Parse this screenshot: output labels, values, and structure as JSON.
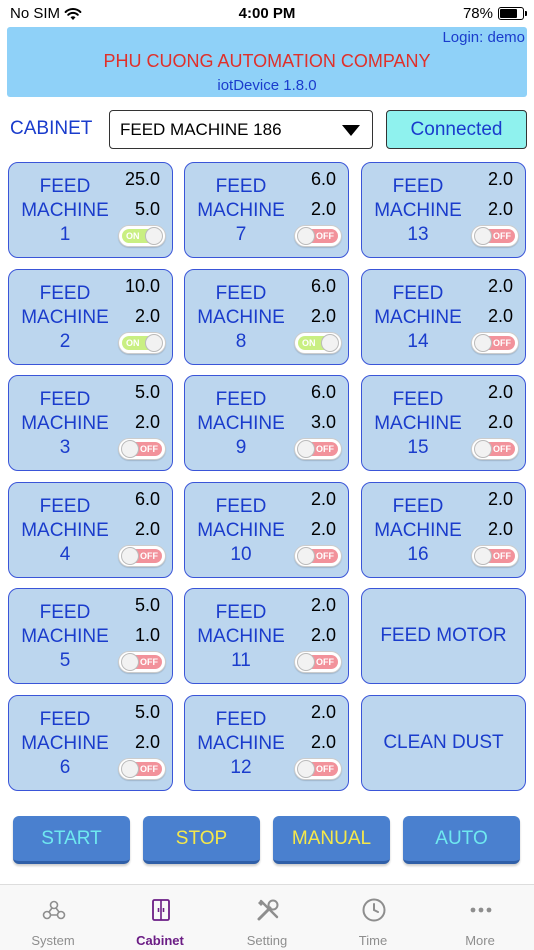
{
  "status_bar": {
    "carrier": "No SIM",
    "time": "4:00 PM",
    "battery": "78%",
    "battery_level": 0.78
  },
  "banner": {
    "login": "Login: demo",
    "company": "PHU CUONG AUTOMATION COMPANY",
    "version": "iotDevice 1.8.0"
  },
  "cabinet": {
    "label": "CABINET",
    "selected": "FEED MACHINE 186",
    "connection_status": "Connected"
  },
  "machines": [
    {
      "line1": "FEED",
      "line2": "MACHINE",
      "number": "1",
      "value1": "25.0",
      "value2": "5.0",
      "switch": "ON"
    },
    {
      "line1": "FEED",
      "line2": "MACHINE",
      "number": "2",
      "value1": "10.0",
      "value2": "2.0",
      "switch": "ON"
    },
    {
      "line1": "FEED",
      "line2": "MACHINE",
      "number": "3",
      "value1": "5.0",
      "value2": "2.0",
      "switch": "OFF"
    },
    {
      "line1": "FEED",
      "line2": "MACHINE",
      "number": "4",
      "value1": "6.0",
      "value2": "2.0",
      "switch": "OFF"
    },
    {
      "line1": "FEED",
      "line2": "MACHINE",
      "number": "5",
      "value1": "5.0",
      "value2": "1.0",
      "switch": "OFF"
    },
    {
      "line1": "FEED",
      "line2": "MACHINE",
      "number": "6",
      "value1": "5.0",
      "value2": "2.0",
      "switch": "OFF"
    },
    {
      "line1": "FEED",
      "line2": "MACHINE",
      "number": "7",
      "value1": "6.0",
      "value2": "2.0",
      "switch": "OFF"
    },
    {
      "line1": "FEED",
      "line2": "MACHINE",
      "number": "8",
      "value1": "6.0",
      "value2": "2.0",
      "switch": "ON"
    },
    {
      "line1": "FEED",
      "line2": "MACHINE",
      "number": "9",
      "value1": "6.0",
      "value2": "3.0",
      "switch": "OFF"
    },
    {
      "line1": "FEED",
      "line2": "MACHINE",
      "number": "10",
      "value1": "2.0",
      "value2": "2.0",
      "switch": "OFF"
    },
    {
      "line1": "FEED",
      "line2": "MACHINE",
      "number": "11",
      "value1": "2.0",
      "value2": "2.0",
      "switch": "OFF"
    },
    {
      "line1": "FEED",
      "line2": "MACHINE",
      "number": "12",
      "value1": "2.0",
      "value2": "2.0",
      "switch": "OFF"
    },
    {
      "line1": "FEED",
      "line2": "MACHINE",
      "number": "13",
      "value1": "2.0",
      "value2": "2.0",
      "switch": "OFF"
    },
    {
      "line1": "FEED",
      "line2": "MACHINE",
      "number": "14",
      "value1": "2.0",
      "value2": "2.0",
      "switch": "OFF"
    },
    {
      "line1": "FEED",
      "line2": "MACHINE",
      "number": "15",
      "value1": "2.0",
      "value2": "2.0",
      "switch": "OFF"
    },
    {
      "line1": "FEED",
      "line2": "MACHINE",
      "number": "16",
      "value1": "2.0",
      "value2": "2.0",
      "switch": "OFF"
    }
  ],
  "specials": {
    "feed_motor": "FEED MOTOR",
    "clean_dust": "CLEAN DUST"
  },
  "actions": [
    {
      "label": "START",
      "color": "#6fe8f0"
    },
    {
      "label": "STOP",
      "color": "#f5e84a"
    },
    {
      "label": "MANUAL",
      "color": "#f5e84a"
    },
    {
      "label": "AUTO",
      "color": "#6fe8f0"
    }
  ],
  "tabs": [
    {
      "label": "System",
      "icon": "system-icon",
      "active": false
    },
    {
      "label": "Cabinet",
      "icon": "cabinet-icon",
      "active": true
    },
    {
      "label": "Setting",
      "icon": "tools-icon",
      "active": false
    },
    {
      "label": "Time",
      "icon": "clock-icon",
      "active": false
    },
    {
      "label": "More",
      "icon": "more-icon",
      "active": false
    }
  ],
  "colors": {
    "accent": "#1a3ccc",
    "banner": "#8fd1f8",
    "tile": "#bcd6ee",
    "active_tab": "#6b1d85",
    "switch_on": "#c9ef82",
    "switch_off": "#f2929b"
  }
}
